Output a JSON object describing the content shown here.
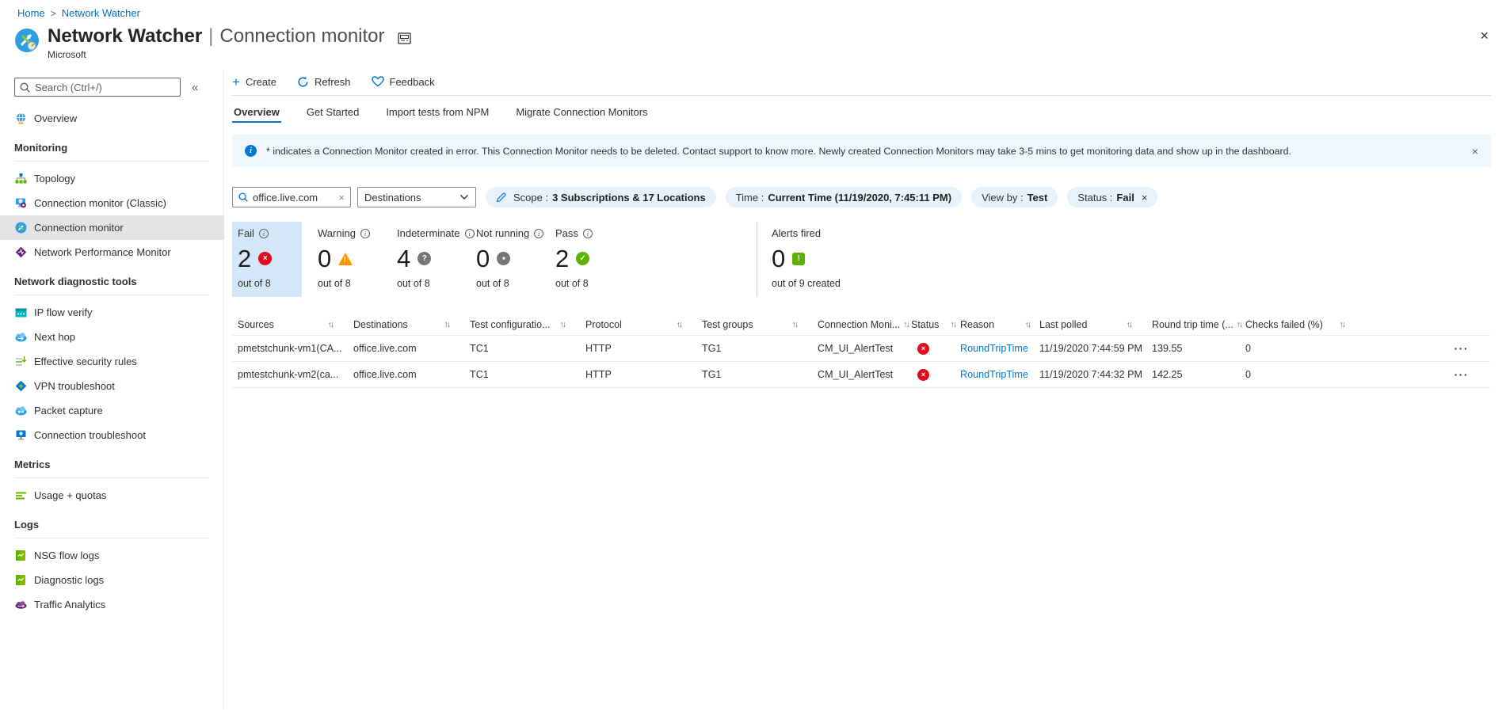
{
  "ui": {
    "sort_glyph": "↑↓",
    "row_menu_glyph": "···",
    "info_glyph": "i",
    "close_glyph": "×",
    "collapse_glyph": "«",
    "plus_glyph": "+",
    "breadcrumb_separator": ">",
    "title_divider": "|",
    "glyphs": {
      "fail": "×",
      "warning": "!",
      "indeterminate": "?",
      "not_running": "■",
      "pass": "✓",
      "alert": "!"
    }
  },
  "colors": {
    "accent": "#0078d4",
    "link": "#0072c9",
    "error": "#e00b1c",
    "warning": "#ff9300",
    "success": "#5db300",
    "neutral": "#767674",
    "selected_card_bg": "#d3e7f8",
    "banner_bg": "#eff6fc",
    "pill_bg": "#e8f2fb",
    "active_item_bg": "#e4e4e4"
  },
  "breadcrumb": {
    "home": "Home",
    "current": "Network Watcher"
  },
  "header": {
    "title": "Network Watcher",
    "page": "Connection monitor",
    "publisher": "Microsoft"
  },
  "sidebar": {
    "search_placeholder": "Search (Ctrl+/)",
    "overview_label": "Overview",
    "sections": [
      {
        "title": "Monitoring",
        "items": [
          {
            "label": "Topology"
          },
          {
            "label": "Connection monitor (Classic)"
          },
          {
            "label": "Connection monitor"
          },
          {
            "label": "Network Performance Monitor"
          }
        ]
      },
      {
        "title": "Network diagnostic tools",
        "items": [
          {
            "label": "IP flow verify"
          },
          {
            "label": "Next hop"
          },
          {
            "label": "Effective security rules"
          },
          {
            "label": "VPN troubleshoot"
          },
          {
            "label": "Packet capture"
          },
          {
            "label": "Connection troubleshoot"
          }
        ]
      },
      {
        "title": "Metrics",
        "items": [
          {
            "label": "Usage + quotas"
          }
        ]
      },
      {
        "title": "Logs",
        "items": [
          {
            "label": "NSG flow logs"
          },
          {
            "label": "Diagnostic logs"
          },
          {
            "label": "Traffic Analytics"
          }
        ]
      }
    ]
  },
  "toolbar": {
    "create": "Create",
    "refresh": "Refresh",
    "feedback": "Feedback"
  },
  "tabs": [
    {
      "label": "Overview"
    },
    {
      "label": "Get Started"
    },
    {
      "label": "Import tests from NPM"
    },
    {
      "label": "Migrate Connection Monitors"
    }
  ],
  "banner": {
    "text": "* indicates a Connection Monitor created in error. This Connection Monitor needs to be deleted. Contact support to know more. Newly created Connection Monitors may take 3-5 mins to get monitoring data and show up in the dashboard."
  },
  "filters": {
    "search_value": "office.live.com",
    "dropdown_value": "Destinations",
    "scope_label": "Scope :",
    "scope_value": "3 Subscriptions & 17 Locations",
    "time_label": "Time :",
    "time_value": "Current Time (11/19/2020, 7:45:11 PM)",
    "viewby_label": "View by :",
    "viewby_value": "Test",
    "status_label": "Status :",
    "status_value": "Fail"
  },
  "summary": {
    "cards": [
      {
        "label": "Fail",
        "value": "2",
        "sub": "out of 8"
      },
      {
        "label": "Warning",
        "value": "0",
        "sub": "out of 8"
      },
      {
        "label": "Indeterminate",
        "value": "4",
        "sub": "out of 8"
      },
      {
        "label": "Not running",
        "value": "0",
        "sub": "out of 8"
      },
      {
        "label": "Pass",
        "value": "2",
        "sub": "out of 8"
      }
    ],
    "alerts": {
      "label": "Alerts fired",
      "value": "0",
      "sub": "out of 9 created"
    }
  },
  "table": {
    "headers": [
      "Sources",
      "Destinations",
      "Test configuratio...",
      "Protocol",
      "Test groups",
      "Connection Moni...",
      "Status",
      "Reason",
      "Last polled",
      "Round trip time (...",
      "Checks failed (%)"
    ],
    "rows": [
      {
        "sources": "pmetstchunk-vm1(CA...",
        "destinations": "office.live.com",
        "test_configuration": "TC1",
        "protocol": "HTTP",
        "test_groups": "TG1",
        "connection_monitor": "CM_UI_AlertTest",
        "reason": "RoundTripTime",
        "last_polled": "11/19/2020 7:44:59 PM",
        "round_trip_time": "139.55",
        "checks_failed": "0"
      },
      {
        "sources": "pmtestchunk-vm2(ca...",
        "destinations": "office.live.com",
        "test_configuration": "TC1",
        "protocol": "HTTP",
        "test_groups": "TG1",
        "connection_monitor": "CM_UI_AlertTest",
        "reason": "RoundTripTime",
        "last_polled": "11/19/2020 7:44:32 PM",
        "round_trip_time": "142.25",
        "checks_failed": "0"
      }
    ]
  }
}
